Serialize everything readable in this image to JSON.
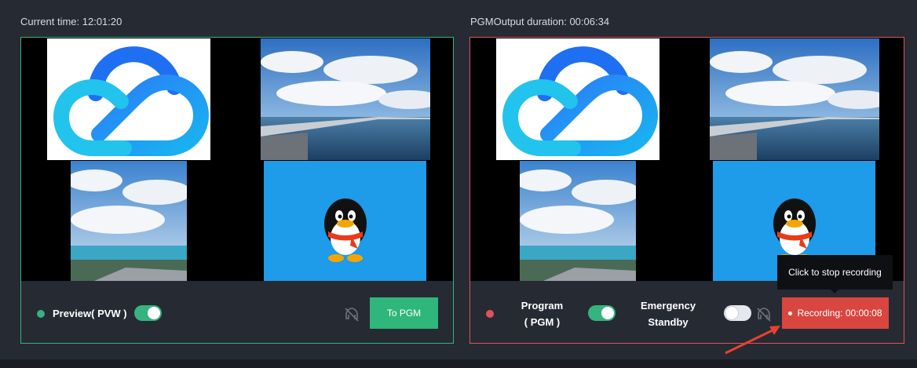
{
  "left": {
    "header": "Current time: 12:01:20",
    "preview_label": "Preview( PVW )",
    "to_pgm_label": "To PGM",
    "toggle_on": true
  },
  "right": {
    "header": "PGMOutput duration: 00:06:34",
    "program_label_line1": "Program",
    "program_label_line2": "( PGM )",
    "emergency_label_line1": "Emergency",
    "emergency_label_line2": "Standby",
    "program_toggle_on": true,
    "emergency_toggle_on": false,
    "record_label": "Recording: 00:00:08",
    "tooltip": "Click to stop recording"
  },
  "colors": {
    "preview_green": "#36b37e",
    "program_red": "#e0525a",
    "record_red": "#d9453f",
    "background": "#262a33"
  },
  "icons": {
    "audio_muted": "muted-speaker-icon",
    "cloud_logo": "tencent-cloud-logo",
    "penguin": "qq-penguin-icon"
  }
}
